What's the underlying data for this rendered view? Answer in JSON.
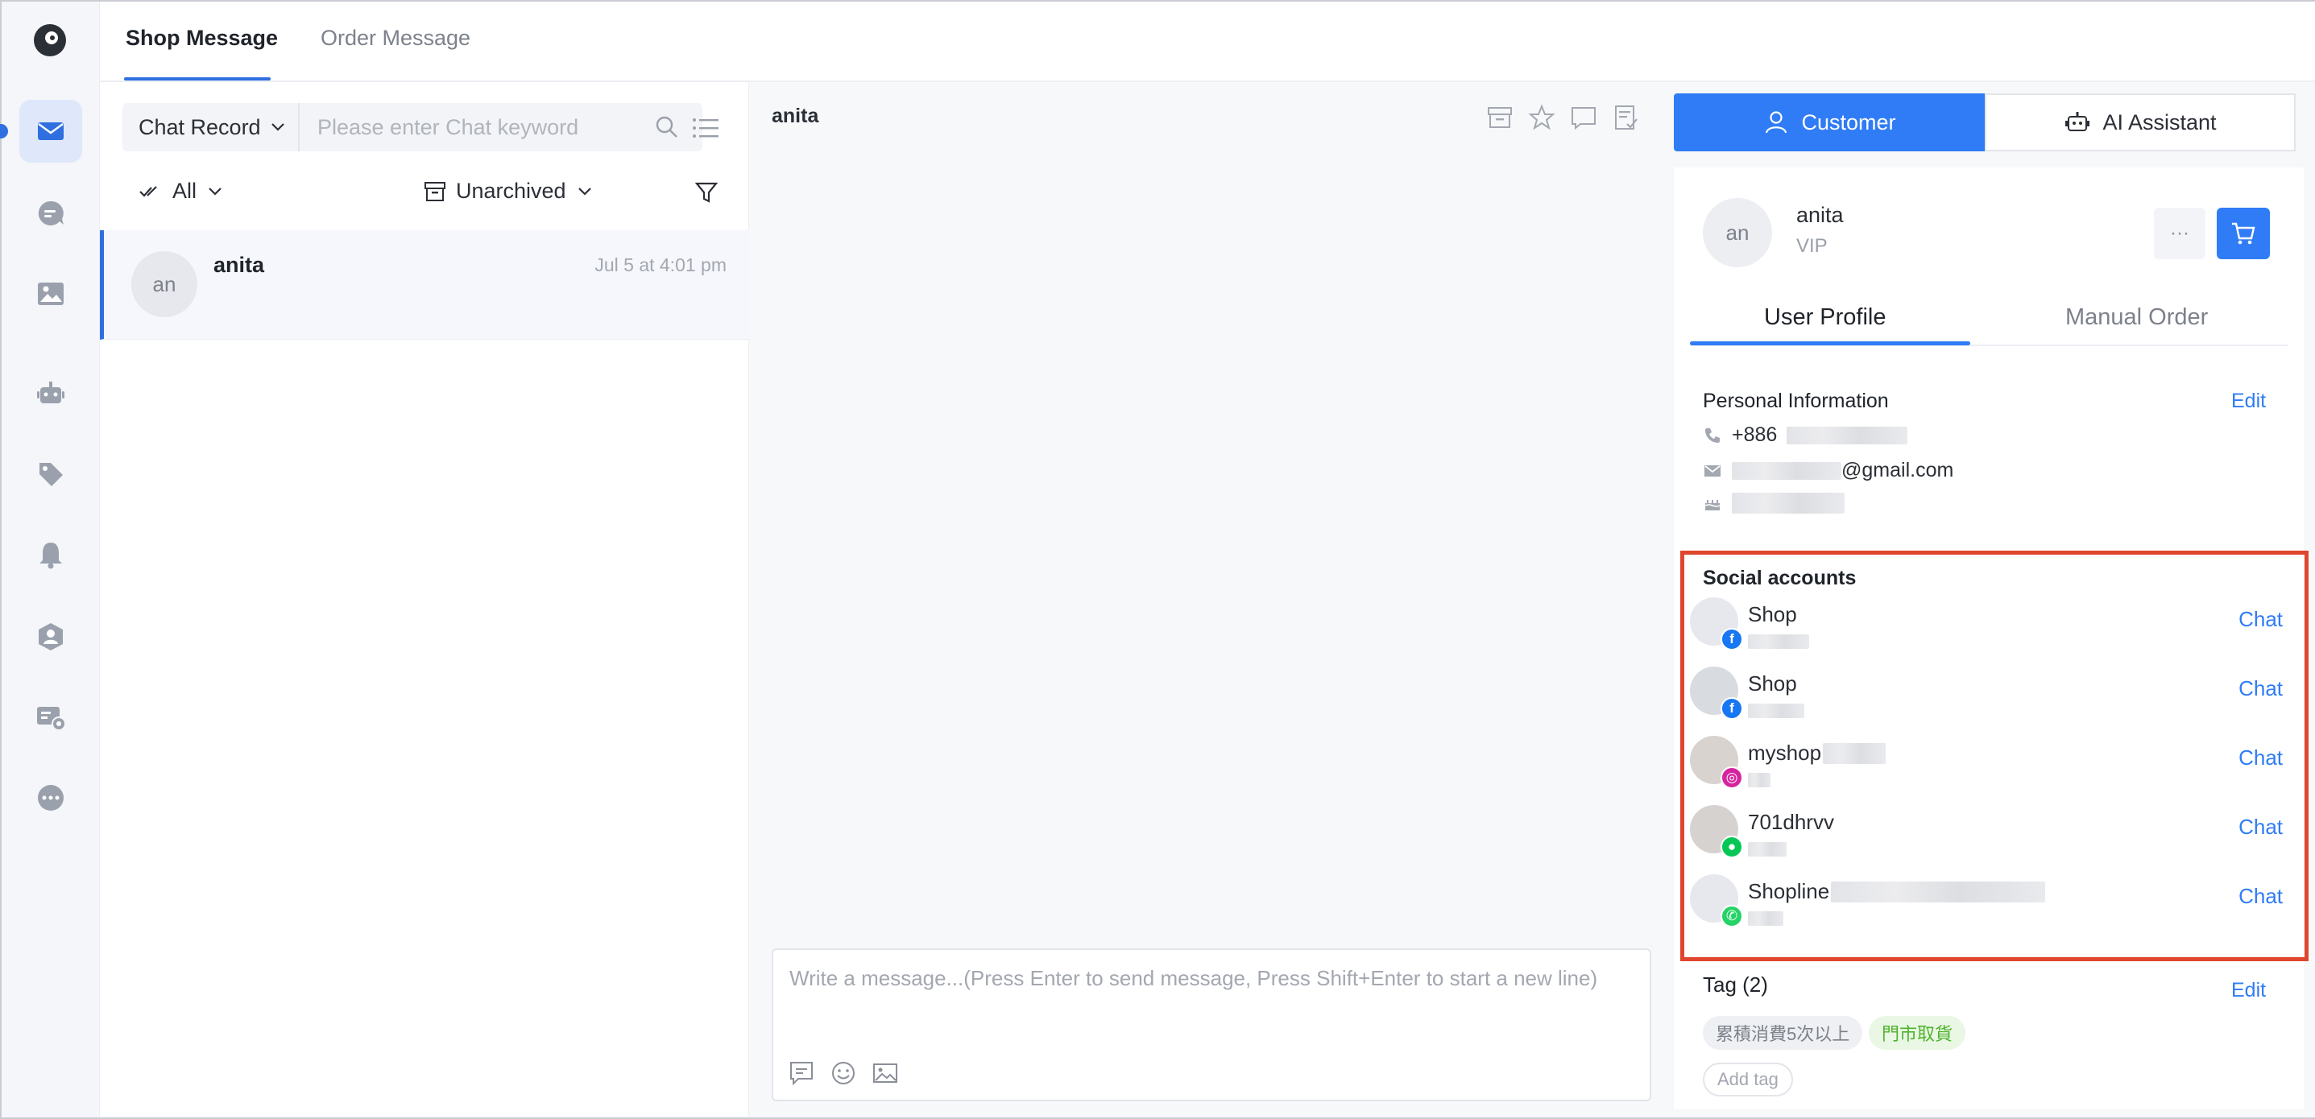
{
  "top_tabs": [
    "Shop Message",
    "Order Message"
  ],
  "search": {
    "record_type": "Chat Record",
    "placeholder": "Please enter Chat keyword"
  },
  "filters": {
    "read": "All",
    "archive": "Unarchived"
  },
  "conversations": [
    {
      "initials": "an",
      "name": "anita",
      "time": "Jul 5 at 4:01 pm"
    }
  ],
  "chat": {
    "title": "anita",
    "composer_placeholder": "Write a message...(Press Enter to send message, Press Shift+Enter to start a new line)"
  },
  "side_tabs": {
    "customer": "Customer",
    "ai": "AI Assistant"
  },
  "profile": {
    "initials": "an",
    "name": "anita",
    "level": "VIP",
    "more": "···"
  },
  "sub_tabs": {
    "profile": "User Profile",
    "manual_order": "Manual Order"
  },
  "personal": {
    "title": "Personal Information",
    "edit": "Edit",
    "phone_prefix": "+886",
    "email_suffix": "@gmail.com"
  },
  "social": {
    "title": "Social accounts",
    "chat_label": "Chat",
    "accounts": [
      {
        "name": "Shop",
        "platform": "facebook"
      },
      {
        "name": "Shop",
        "platform": "facebook"
      },
      {
        "name": "myshop",
        "platform": "instagram"
      },
      {
        "name": "701dhrvv",
        "platform": "line"
      },
      {
        "name": "Shopline",
        "platform": "whatsapp"
      }
    ]
  },
  "tags": {
    "title": "Tag (2)",
    "edit": "Edit",
    "items": [
      "累積消費5次以上",
      "門市取貨"
    ],
    "add": "Add tag"
  },
  "colors": {
    "primary": "#2f7cf6",
    "highlight": "#e0452e",
    "facebook": "#1877f2",
    "instagram": "#d6249f",
    "line": "#06c755",
    "whatsapp": "#25d366"
  }
}
